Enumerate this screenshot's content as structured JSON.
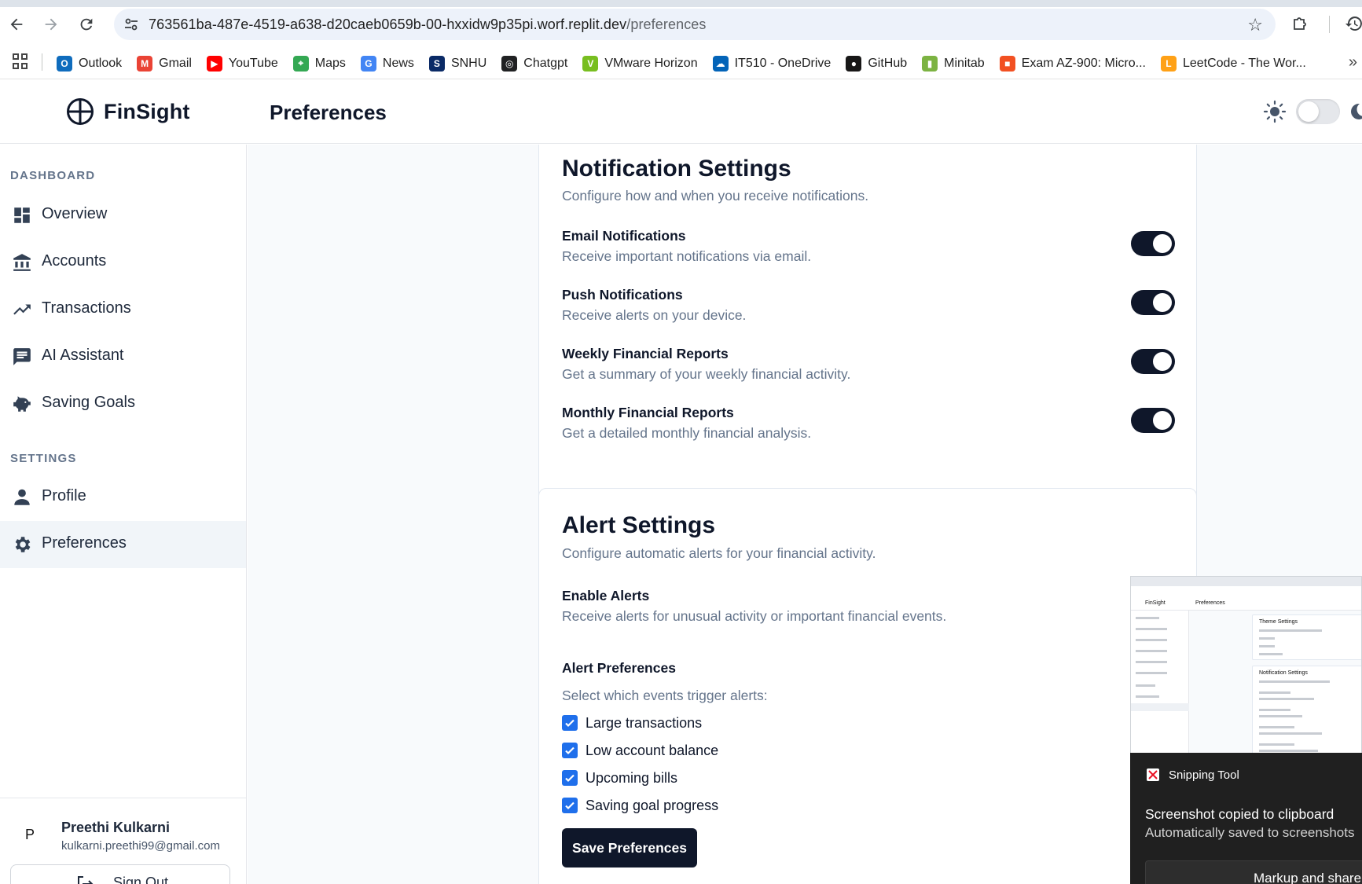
{
  "browser": {
    "url_host": "763561ba-487e-4519-a638-d20caeb0659b-00-hxxidw9p35pi.worf.replit.dev",
    "url_path": "/preferences",
    "bookmarks": [
      {
        "label": "Outlook",
        "icon": "outlook-icon",
        "color": "#0f6cbd"
      },
      {
        "label": "Gmail",
        "icon": "gmail-icon",
        "color": "#ea4335"
      },
      {
        "label": "YouTube",
        "icon": "youtube-icon",
        "color": "#ff0000"
      },
      {
        "label": "Maps",
        "icon": "maps-icon",
        "color": "#34a853"
      },
      {
        "label": "News",
        "icon": "news-icon",
        "color": "#4285f4"
      },
      {
        "label": "SNHU",
        "icon": "snhu-icon",
        "color": "#0a2a66"
      },
      {
        "label": "Chatgpt",
        "icon": "chatgpt-icon",
        "color": "#202123"
      },
      {
        "label": "VMware Horizon",
        "icon": "vmware-icon",
        "color": "#78be20"
      },
      {
        "label": "IT510 - OneDrive",
        "icon": "onedrive-icon",
        "color": "#0364b8"
      },
      {
        "label": "GitHub",
        "icon": "github-icon",
        "color": "#181717"
      },
      {
        "label": "Minitab",
        "icon": "minitab-icon",
        "color": "#7cb342"
      },
      {
        "label": "Exam AZ-900: Micro...",
        "icon": "microsoft-icon",
        "color": "#f25022"
      },
      {
        "label": "LeetCode - The Wor...",
        "icon": "leetcode-icon",
        "color": "#ffa116"
      }
    ]
  },
  "app": {
    "name": "FinSight",
    "page_title": "Preferences",
    "accent": "#0f172a"
  },
  "sidebar": {
    "dashboard_label": "DASHBOARD",
    "settings_label": "SETTINGS",
    "items": [
      {
        "label": "Overview",
        "icon": "dashboard-icon"
      },
      {
        "label": "Accounts",
        "icon": "bank-icon"
      },
      {
        "label": "Transactions",
        "icon": "trending-up-icon"
      },
      {
        "label": "AI Assistant",
        "icon": "chat-icon"
      },
      {
        "label": "Saving Goals",
        "icon": "piggy-bank-icon"
      },
      {
        "label": "Profile",
        "icon": "person-icon"
      },
      {
        "label": "Preferences",
        "icon": "gear-icon",
        "active": true
      }
    ],
    "user": {
      "initial": "P",
      "name": "Preethi Kulkarni",
      "email": "kulkarni.preethi99@gmail.com"
    },
    "sign_out": "Sign Out"
  },
  "notifications": {
    "title": "Notification Settings",
    "description": "Configure how and when you receive notifications.",
    "rows": [
      {
        "title": "Email Notifications",
        "desc": "Receive important notifications via email.",
        "enabled": true
      },
      {
        "title": "Push Notifications",
        "desc": "Receive alerts on your device.",
        "enabled": true
      },
      {
        "title": "Weekly Financial Reports",
        "desc": "Get a summary of your weekly financial activity.",
        "enabled": true
      },
      {
        "title": "Monthly Financial Reports",
        "desc": "Get a detailed monthly financial analysis.",
        "enabled": true
      }
    ]
  },
  "alerts": {
    "title": "Alert Settings",
    "description": "Configure automatic alerts for your financial activity.",
    "enable_title": "Enable Alerts",
    "enable_desc": "Receive alerts for unusual activity or important financial events.",
    "prefs_title": "Alert Preferences",
    "prefs_desc": "Select which events trigger alerts:",
    "checkboxes": [
      {
        "label": "Large transactions",
        "checked": true
      },
      {
        "label": "Low account balance",
        "checked": true
      },
      {
        "label": "Upcoming bills",
        "checked": true
      },
      {
        "label": "Saving goal progress",
        "checked": true
      }
    ],
    "save_label": "Save Preferences"
  },
  "snipping_tool": {
    "title": "Snipping Tool",
    "message": "Screenshot copied to clipboard",
    "sub_message": "Automatically saved to screenshots",
    "button": "Markup and share",
    "thumb": {
      "logo": "FinSight",
      "page": "Preferences",
      "card1": "Theme Settings",
      "card2": "Notification Settings"
    }
  }
}
